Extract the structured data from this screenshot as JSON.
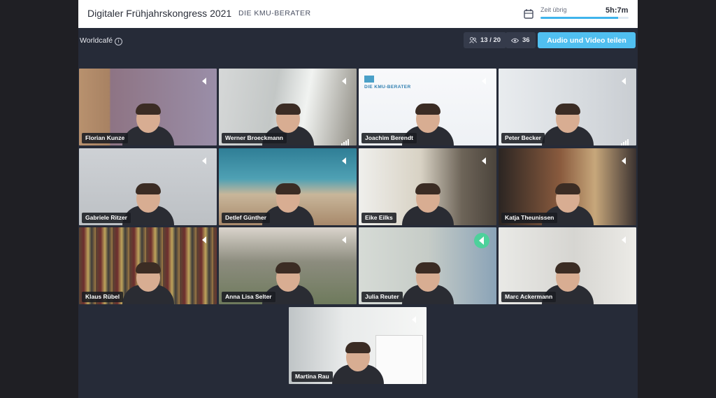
{
  "header": {
    "event_title": "Digitaler Frühjahrskongress 2021",
    "brand": "DIE KMU-BERATER",
    "time_label": "Zeit übrig",
    "time_value": "5h:7m",
    "time_progress_percent": 88
  },
  "toolbar": {
    "room_name": "Worldcafé",
    "participants": "13 / 20",
    "viewers": "36",
    "share_button": "Audio und Video teilen"
  },
  "colors": {
    "accent": "#50bff0",
    "speaking": "#4dd19b",
    "background": "#262b38"
  },
  "slide_logo_text": "DIE KMU-BERATER",
  "participants": [
    {
      "name": "Florian Kunze",
      "has_badge": true
    },
    {
      "name": "Werner Broeckmann",
      "signal": true
    },
    {
      "name": "Joachim Berendt"
    },
    {
      "name": "Peter Becker",
      "signal": true
    },
    {
      "name": "Gabriele Ritzer"
    },
    {
      "name": "Detlef Günther"
    },
    {
      "name": "Eike Eilks"
    },
    {
      "name": "Katja Theunissen"
    },
    {
      "name": "Klaus Rübel"
    },
    {
      "name": "Anna Lisa Selter"
    },
    {
      "name": "Julia Reuter",
      "speaking": true
    },
    {
      "name": "Marc Ackermann"
    },
    {
      "name": "Martina Rau"
    }
  ]
}
